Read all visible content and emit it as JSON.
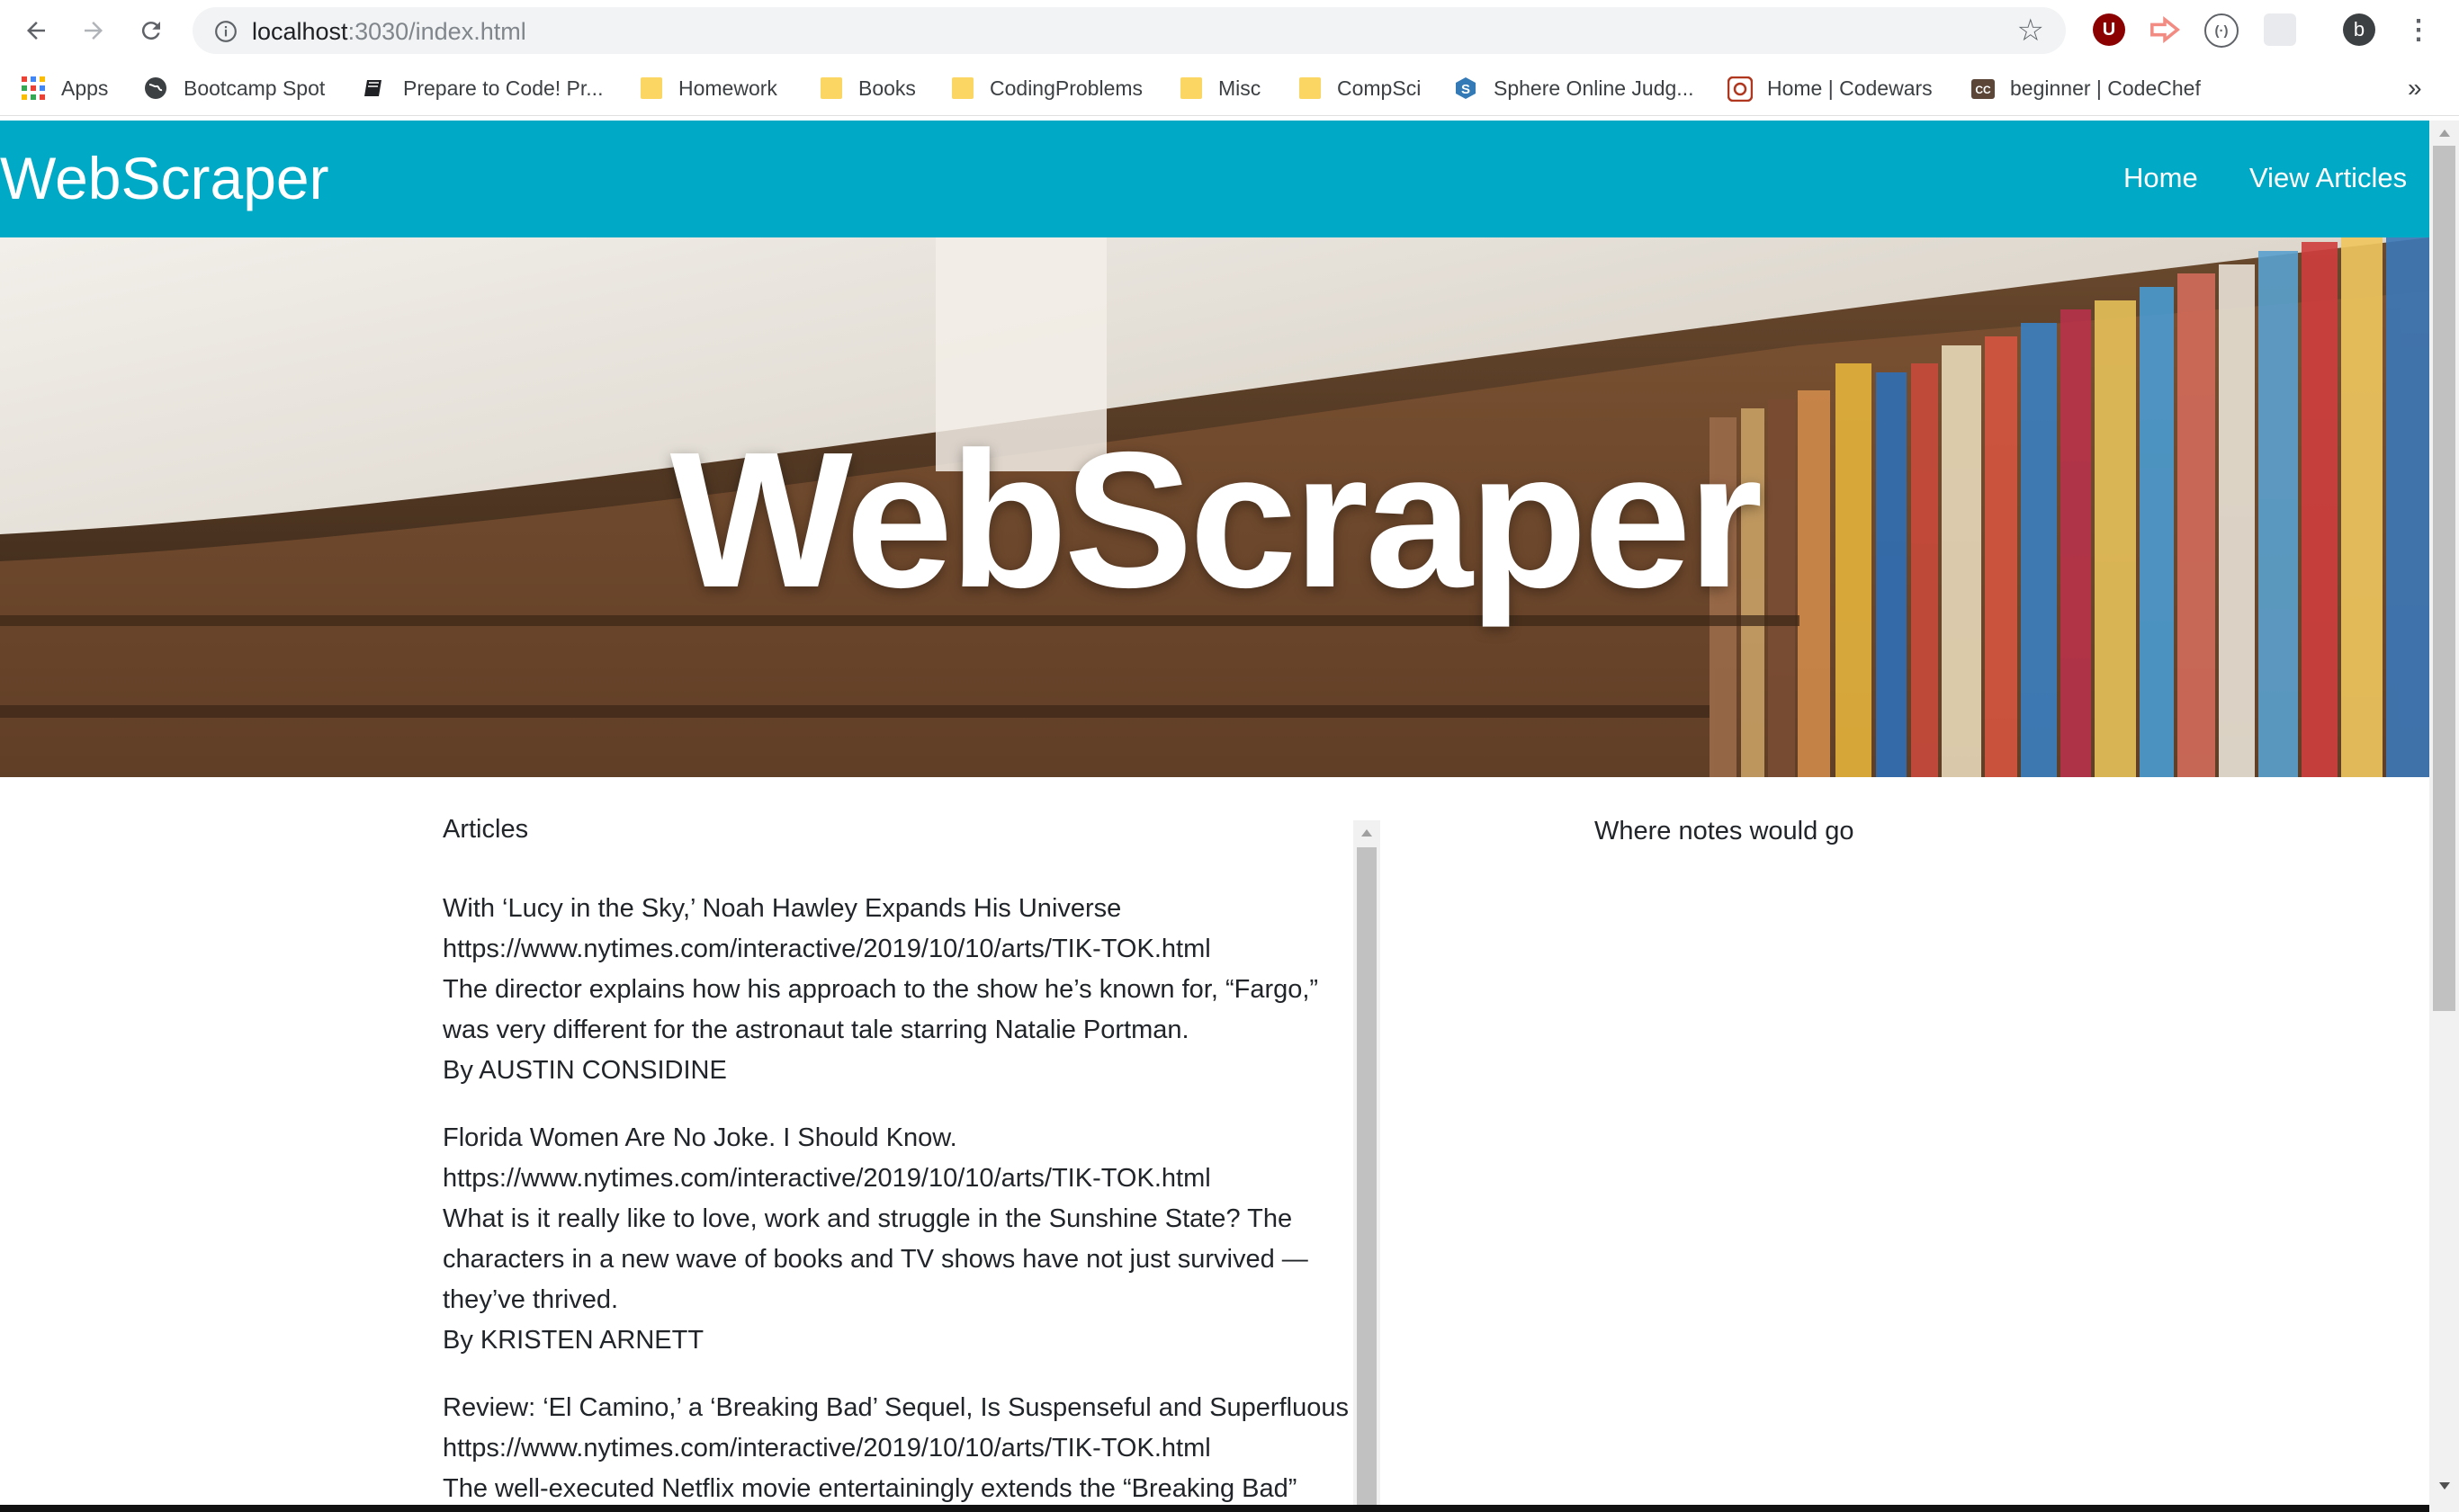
{
  "browser": {
    "url_host": "localhost",
    "url_path": ":3030/index.html",
    "profile_initial": "b",
    "ext_ublock_label": "U",
    "bookmarks": [
      {
        "label": "Apps",
        "icon": "apps-grid-icon"
      },
      {
        "label": "Bootcamp Spot",
        "icon": "globe-icon"
      },
      {
        "label": "Prepare to Code! Pr...",
        "icon": "book-icon"
      },
      {
        "label": "Homework",
        "icon": "folder-icon"
      },
      {
        "label": "Books",
        "icon": "folder-icon"
      },
      {
        "label": "CodingProblems",
        "icon": "folder-icon"
      },
      {
        "label": "Misc",
        "icon": "folder-icon"
      },
      {
        "label": "CompSci",
        "icon": "folder-icon"
      },
      {
        "label": "Sphere Online Judg...",
        "icon": "spoj-icon"
      },
      {
        "label": "Home | Codewars",
        "icon": "codewars-icon"
      },
      {
        "label": "beginner | CodeChef",
        "icon": "codechef-icon"
      }
    ],
    "bookmarks_overflow": "»"
  },
  "site": {
    "brand": "WebScraper",
    "nav": {
      "home": "Home",
      "view_articles": "View Articles"
    },
    "hero_title": "WebScraper",
    "articles_heading": "Articles",
    "notes_heading": "Where notes would go",
    "articles": [
      {
        "title": "With ‘Lucy in the Sky,’ Noah Hawley Expands His Universe",
        "link": "https://www.nytimes.com/interactive/2019/10/10/arts/TIK-TOK.html",
        "summary": "The director explains how his approach to the show he’s known for, “Fargo,” was very different for the astronaut tale starring Natalie Portman.",
        "byline": "By AUSTIN CONSIDINE"
      },
      {
        "title": "Florida Women Are No Joke. I Should Know.",
        "link": "https://www.nytimes.com/interactive/2019/10/10/arts/TIK-TOK.html",
        "summary": "What is it really like to love, work and struggle in the Sunshine State? The characters in a new wave of books and TV shows have not just survived — they’ve thrived.",
        "byline": "By KRISTEN ARNETT"
      },
      {
        "title": "Review: ‘El Camino,’ a ‘Breaking Bad’ Sequel, Is Suspenseful and Superfluous",
        "link": "https://www.nytimes.com/interactive/2019/10/10/arts/TIK-TOK.html",
        "summary": "The well-executed Netflix movie entertainingly extends the “Breaking Bad”",
        "byline": ""
      }
    ]
  },
  "colors": {
    "navbar": "#00a9c5",
    "text": "#212529"
  }
}
